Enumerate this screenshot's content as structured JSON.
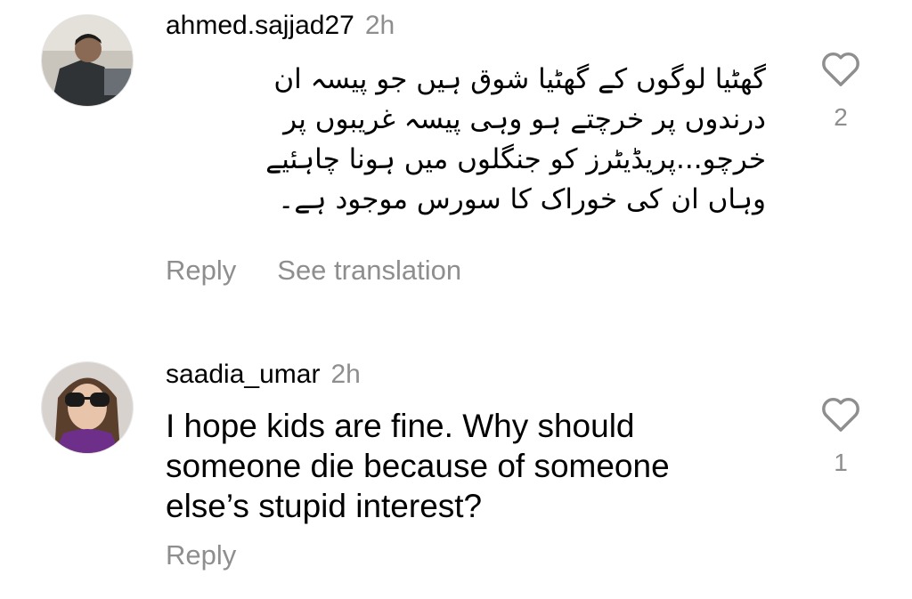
{
  "comments": [
    {
      "username": "ahmed.sajjad27",
      "time": "2h",
      "text_lines": [
        "گھٹیا لوگوں کے گھٹیا شوق ہیں جو پیسہ ان",
        "درندوں پر خرچتے ہو وہی پیسہ غریبوں پر",
        "خرچو...پریڈیٹرز کو جنگلوں میں ہونا چاہئیے",
        "وہاں ان کی خوراک کا سورس موجود ہے۔"
      ],
      "like_count": "2",
      "reply_label": "Reply",
      "translation_label": "See translation"
    },
    {
      "username": "saadia_umar",
      "time": "2h",
      "text_lines": [
        "I hope kids are fine. Why should",
        "someone die because of someone",
        "else’s stupid interest?"
      ],
      "like_count": "1",
      "reply_label": "Reply"
    }
  ],
  "icons": {
    "like": "heart-outline-icon",
    "avatar": "profile-photo"
  },
  "colors": {
    "primary_text": "#000000",
    "secondary_text": "#8e8e8e",
    "background": "#ffffff"
  }
}
